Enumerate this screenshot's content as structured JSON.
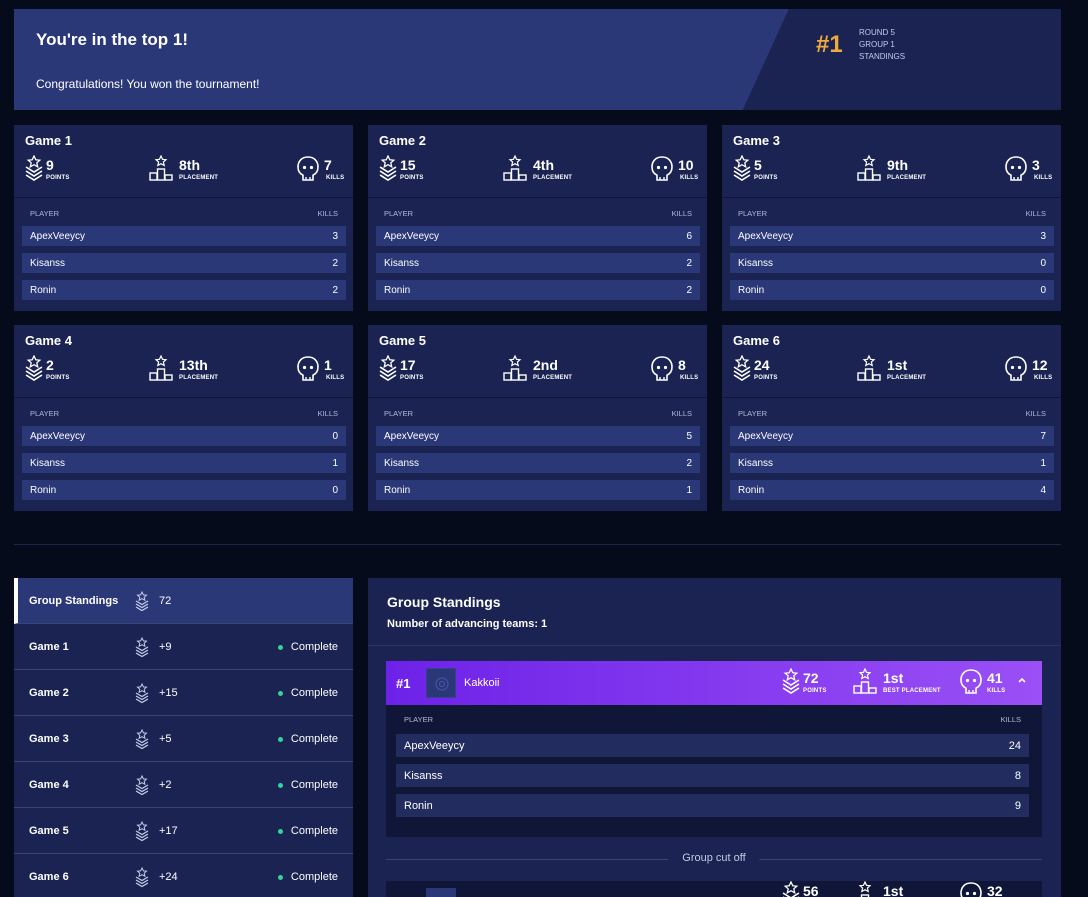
{
  "banner": {
    "title": "You're in the top 1!",
    "subtitle": "Congratulations! You won the tournament!",
    "rank": "#1",
    "round": "ROUND 5",
    "group": "GROUP 1",
    "standings": "STANDINGS"
  },
  "labels": {
    "points": "POINTS",
    "placement": "PLACEMENT",
    "kills": "KILLS",
    "player": "PLAYER",
    "best_placement": "BEST PLACEMENT"
  },
  "games": [
    {
      "name": "Game 1",
      "points": "9",
      "placement": "8th",
      "kills": "7",
      "players": [
        {
          "name": "ApexVeeycy",
          "kills": "3"
        },
        {
          "name": "Kisanss",
          "kills": "2"
        },
        {
          "name": "Ronin",
          "kills": "2"
        }
      ]
    },
    {
      "name": "Game 2",
      "points": "15",
      "placement": "4th",
      "kills": "10",
      "players": [
        {
          "name": "ApexVeeycy",
          "kills": "6"
        },
        {
          "name": "Kisanss",
          "kills": "2"
        },
        {
          "name": "Ronin",
          "kills": "2"
        }
      ]
    },
    {
      "name": "Game 3",
      "points": "5",
      "placement": "9th",
      "kills": "3",
      "players": [
        {
          "name": "ApexVeeycy",
          "kills": "3"
        },
        {
          "name": "Kisanss",
          "kills": "0"
        },
        {
          "name": "Ronin",
          "kills": "0"
        }
      ]
    },
    {
      "name": "Game 4",
      "points": "2",
      "placement": "13th",
      "kills": "1",
      "players": [
        {
          "name": "ApexVeeycy",
          "kills": "0"
        },
        {
          "name": "Kisanss",
          "kills": "1"
        },
        {
          "name": "Ronin",
          "kills": "0"
        }
      ]
    },
    {
      "name": "Game 5",
      "points": "17",
      "placement": "2nd",
      "kills": "8",
      "players": [
        {
          "name": "ApexVeeycy",
          "kills": "5"
        },
        {
          "name": "Kisanss",
          "kills": "2"
        },
        {
          "name": "Ronin",
          "kills": "1"
        }
      ]
    },
    {
      "name": "Game 6",
      "points": "24",
      "placement": "1st",
      "kills": "12",
      "players": [
        {
          "name": "ApexVeeycy",
          "kills": "7"
        },
        {
          "name": "Kisanss",
          "kills": "1"
        },
        {
          "name": "Ronin",
          "kills": "4"
        }
      ]
    }
  ],
  "sidebar": {
    "items": [
      {
        "name": "Group Standings",
        "points": "72",
        "status": ""
      },
      {
        "name": "Game 1",
        "points": "+9",
        "status": "Complete"
      },
      {
        "name": "Game 2",
        "points": "+15",
        "status": "Complete"
      },
      {
        "name": "Game 3",
        "points": "+5",
        "status": "Complete"
      },
      {
        "name": "Game 4",
        "points": "+2",
        "status": "Complete"
      },
      {
        "name": "Game 5",
        "points": "+17",
        "status": "Complete"
      },
      {
        "name": "Game 6",
        "points": "+24",
        "status": "Complete"
      }
    ]
  },
  "standings": {
    "title": "Group Standings",
    "advancing": "Number of advancing teams: 1",
    "cutoff": "Group cut off",
    "team": {
      "rank": "#1",
      "name": "Kakkoii",
      "points": "72",
      "placement": "1st",
      "kills": "41",
      "players": [
        {
          "name": "ApexVeeycy",
          "kills": "24"
        },
        {
          "name": "Kisanss",
          "kills": "8"
        },
        {
          "name": "Ronin",
          "kills": "9"
        }
      ]
    },
    "team2": {
      "points": "56",
      "placement": "1st",
      "kills": "32"
    }
  },
  "colors": {
    "background": "#060b1c",
    "panel": "#1a2352",
    "row": "#2b3877",
    "accent": "#f0aa3c",
    "team_gradient_start": "#6d22e8",
    "team_gradient_end": "#9a50f5",
    "complete_dot": "#34d39a"
  },
  "icons": [
    "chevron-badge-icon",
    "podium-icon",
    "skull-icon",
    "chevron-up-icon",
    "team-logo-icon"
  ]
}
